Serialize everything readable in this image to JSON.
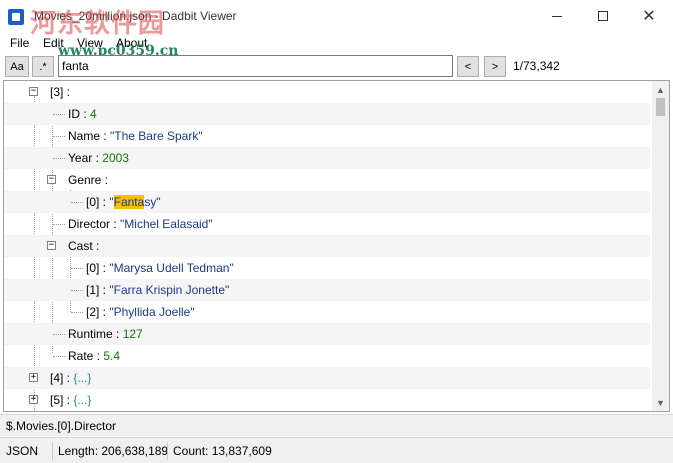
{
  "window": {
    "title": "Movies_20million.json - Dadbit Viewer",
    "watermark": "河东软件园",
    "watermark_url": "www.pc0359.cn"
  },
  "menu": [
    "File",
    "Edit",
    "View",
    "About"
  ],
  "toolbar": {
    "case_label": "Aa",
    "regex_label": ".*",
    "search_value": "fanta",
    "prev_label": "<",
    "next_label": ">",
    "result_count": "1/73,342"
  },
  "tree": {
    "item3": {
      "key": "[3]",
      "sep": " :"
    },
    "id": {
      "key": "ID",
      "sep": " : ",
      "value": "4"
    },
    "name": {
      "key": "Name",
      "sep": " : ",
      "value": "\"The Bare Spark\""
    },
    "year": {
      "key": "Year",
      "sep": " : ",
      "value": "2003"
    },
    "genre": {
      "key": "Genre",
      "sep": " :"
    },
    "genre0": {
      "key": "[0]",
      "sep": "  : ",
      "quote_open": "\"",
      "highlight": "Fanta",
      "rest": "sy\""
    },
    "director": {
      "key": "Director",
      "sep": " : ",
      "value": "\"Michel Ealasaid\""
    },
    "cast": {
      "key": "Cast",
      "sep": " :"
    },
    "cast0": {
      "key": "[0]",
      "sep": "  : ",
      "value": "\"Marysa Udell Tedman\""
    },
    "cast1": {
      "key": "[1]",
      "sep": "  : ",
      "value": "\"Farra Krispin Jonette\""
    },
    "cast2": {
      "key": "[2]",
      "sep": "  : ",
      "value": "\"Phyllida Joelle\""
    },
    "runtime": {
      "key": "Runtime",
      "sep": " : ",
      "value": "127"
    },
    "rate": {
      "key": "Rate",
      "sep": " : ",
      "value": "5.4"
    },
    "item4": {
      "key": "[4]",
      "sep": "  : ",
      "value": "{...}"
    },
    "item5": {
      "key": "[5]",
      "sep": "  : ",
      "value": "{...}"
    }
  },
  "path": "$.Movies.[0].Director",
  "status": {
    "format": "JSON",
    "length": "Length: 206,638,189",
    "count": "Count: 13,837,609"
  },
  "colors": {
    "string": "#1a3a8a",
    "number": "#0a7a0a",
    "highlight": "#f6c000",
    "collapsed": "#2a8aa0"
  }
}
